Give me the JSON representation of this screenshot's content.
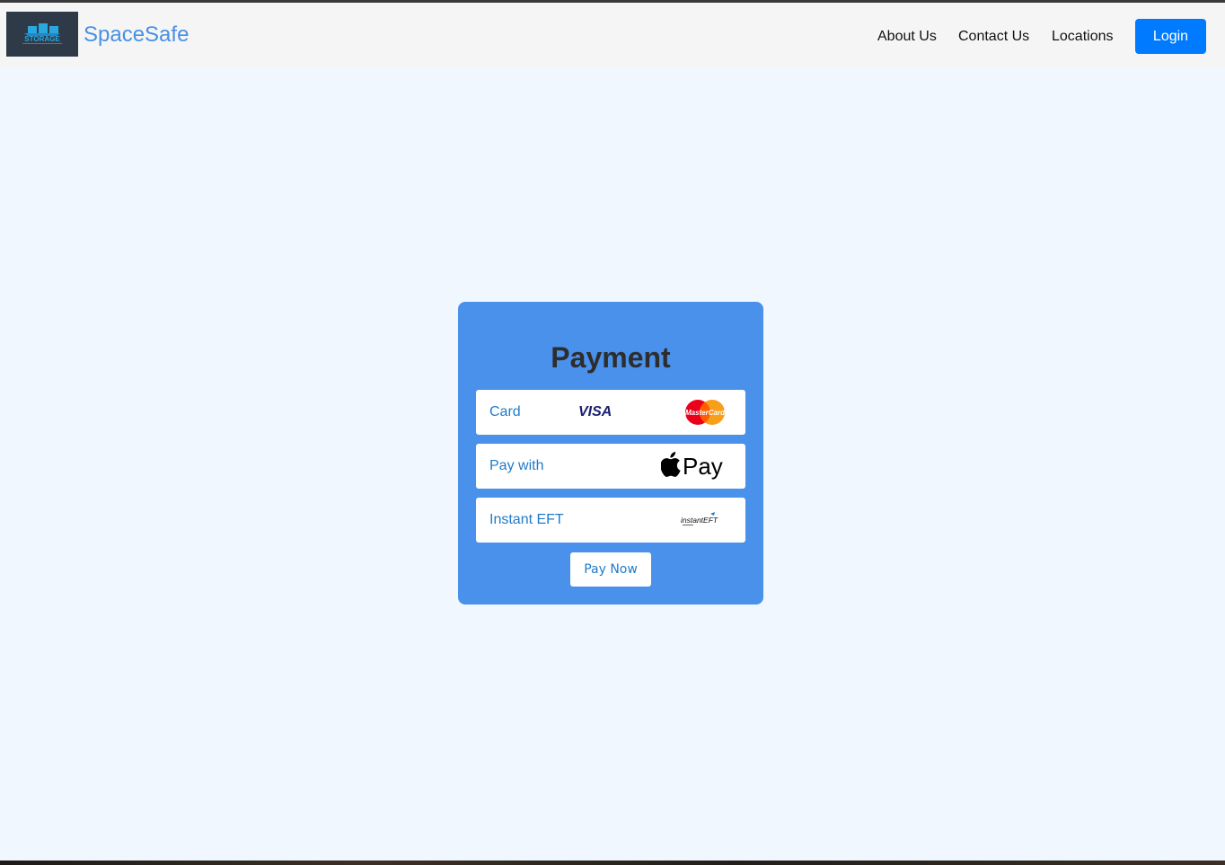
{
  "header": {
    "brand": "SpaceSafe",
    "logo_text": "STORAGE",
    "nav": [
      {
        "label": "About Us"
      },
      {
        "label": "Contact Us"
      },
      {
        "label": "Locations"
      }
    ],
    "login_label": "Login"
  },
  "payment": {
    "title": "Payment",
    "options": [
      {
        "label": "Card",
        "logos": [
          "VISA",
          "MasterCard"
        ]
      },
      {
        "label": "Pay with",
        "logos": [
          "Pay"
        ]
      },
      {
        "label": "Instant EFT",
        "logos": [
          "instantEFT"
        ]
      }
    ],
    "pay_button": "Pay Now"
  },
  "colors": {
    "brand": "#4a90e2",
    "primary_button": "#007bff",
    "card_background": "#4a91eb",
    "option_text": "#1f7bc8",
    "page_background": "#f0f7ff"
  },
  "icons": [
    "visa-logo-icon",
    "mastercard-logo-icon",
    "apple-pay-logo-icon",
    "instant-eft-logo-icon"
  ]
}
